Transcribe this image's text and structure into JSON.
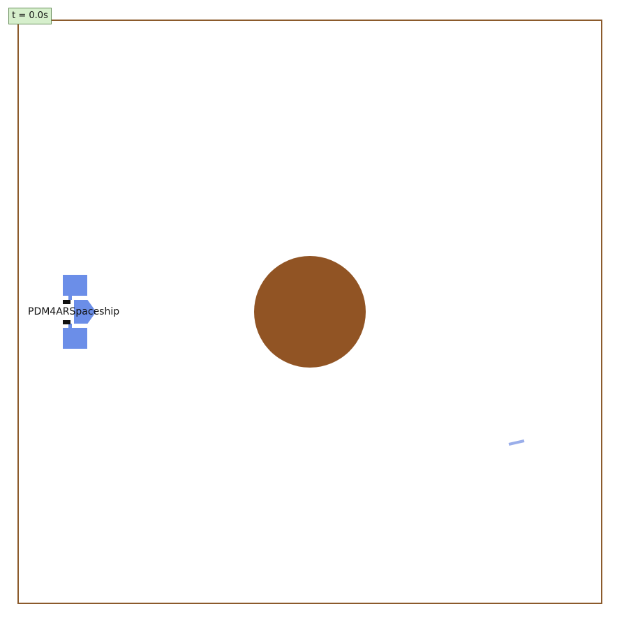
{
  "time_label": "t = 0.0s",
  "spaceship": {
    "name": "PDM4ARSpaceship",
    "color": "#6b8ee8"
  },
  "planet": {
    "color": "#915424"
  },
  "boundary": {
    "color": "#8b5a2b"
  },
  "goal_marker": {
    "color": "#9aaeea"
  }
}
